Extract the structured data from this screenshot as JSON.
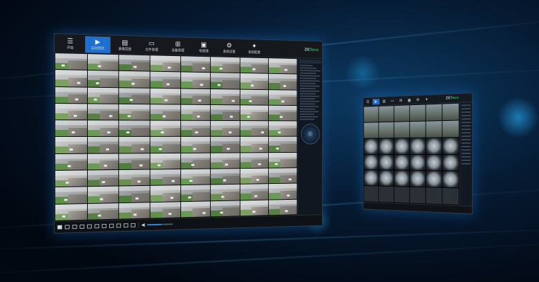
{
  "app": {
    "brand_prefix": "ZK",
    "brand_suffix": "Teco"
  },
  "toolbar": {
    "items": [
      {
        "icon": "menu-icon",
        "label": "开始"
      },
      {
        "icon": "camera-icon",
        "label": "实时预览",
        "active": true
      },
      {
        "icon": "film-icon",
        "label": "录像回放"
      },
      {
        "icon": "folder-icon",
        "label": "文件管理"
      },
      {
        "icon": "network-icon",
        "label": "设备管理"
      },
      {
        "icon": "screen-icon",
        "label": "电视墙"
      },
      {
        "icon": "gear-icon",
        "label": "系统设置"
      },
      {
        "icon": "settings-icon",
        "label": "系统配置"
      }
    ]
  },
  "video_grid": {
    "columns": 8,
    "rows": 10
  },
  "statusbar": {
    "layout_buttons": 11,
    "volume_icon": "speaker-icon",
    "volume_level": 0.55
  },
  "second_screen": {
    "columns": 6,
    "rows": 6
  },
  "colors": {
    "accent": "#1d6fd0",
    "background": "#061a32",
    "brand_green": "#2fa84f"
  }
}
